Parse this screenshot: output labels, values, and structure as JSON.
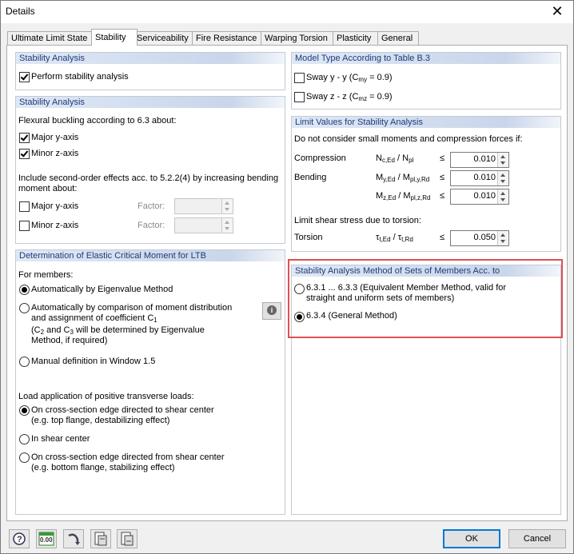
{
  "window": {
    "title": "Details",
    "close_glyph": "✕"
  },
  "tabs": [
    "Ultimate Limit State",
    "Stability",
    "Serviceability",
    "Fire Resistance",
    "Warping Torsion",
    "Plasticity",
    "General"
  ],
  "stability_analysis_1": {
    "header": "Stability Analysis",
    "perform_label": "Perform stability analysis",
    "perform_checked": true
  },
  "stability_analysis_2": {
    "header": "Stability Analysis",
    "flexural_label": "Flexural buckling according to 6.3 about:",
    "major_y": {
      "label": "Major y-axis",
      "checked": true
    },
    "minor_z": {
      "label": "Minor z-axis",
      "checked": true
    },
    "second_order_line1": "Include second-order effects acc. to 5.2.2(4) by increasing bending",
    "second_order_line2": "moment about:",
    "so_major_y": {
      "label": "Major y-axis",
      "checked": false,
      "factor_label": "Factor:",
      "factor_value": ""
    },
    "so_minor_z": {
      "label": "Minor z-axis",
      "checked": false,
      "factor_label": "Factor:",
      "factor_value": ""
    }
  },
  "ltb": {
    "header": "Determination of Elastic Critical Moment for LTB",
    "for_members": "For members:",
    "options": [
      {
        "text": "Automatically by Eigenvalue Method",
        "selected": true
      },
      {
        "text1": "Automatically by comparison of moment distribution",
        "text2": "and assignment of coefficient C",
        "text2_sub": "1",
        "text3a": "(C",
        "text3_sub1": "2",
        "text3b": " and C",
        "text3_sub2": "3",
        "text3c": " will be determined by Eigenvalue",
        "text4": "Method, if required)",
        "selected": false
      },
      {
        "text": "Manual definition in Window 1.5",
        "selected": false
      }
    ],
    "load_label": "Load application of positive transverse loads:",
    "load_options": [
      {
        "line1": "On cross-section edge directed to shear center",
        "line2": "(e.g. top flange, destabilizing effect)",
        "selected": true
      },
      {
        "line1": "In shear center",
        "line2": "",
        "selected": false
      },
      {
        "line1": "On cross-section edge directed from shear center",
        "line2": "(e.g. bottom flange, stabilizing effect)",
        "selected": false
      }
    ],
    "info_glyph": "i"
  },
  "model_type": {
    "header": "Model Type According to Table B.3",
    "sway_y": {
      "prefix": "Sway y - y (C",
      "sub": "my",
      "suffix": " = 0.9)",
      "checked": false
    },
    "sway_z": {
      "prefix": "Sway z - z (C",
      "sub": "mz",
      "suffix": " = 0.9)",
      "checked": false
    }
  },
  "limit_values": {
    "header": "Limit Values for Stability Analysis",
    "intro": "Do not consider small moments and compression forces if:",
    "compression": {
      "label": "Compression",
      "f_a": "N",
      "f_a_sub": "c,Ed",
      "f_b": " / N",
      "f_b_sub": "pl",
      "le": "≤",
      "value": "0.010"
    },
    "bending": {
      "label": "Bending",
      "f_a": "M",
      "f_a_sub": "y,Ed",
      "f_b": " / M",
      "f_b_sub": "pl,y,Rd",
      "le": "≤",
      "value": "0.010"
    },
    "bending2": {
      "f_a": "M",
      "f_a_sub": "z,Ed",
      "f_b": " / M",
      "f_b_sub": "pl,z,Rd",
      "le": "≤",
      "value": "0.010"
    },
    "shear_intro": "Limit shear stress due to torsion:",
    "torsion": {
      "label": "Torsion",
      "f_a": "τ",
      "f_a_sub": "t,Ed",
      "f_b": " / τ",
      "f_b_sub": "t,Rd",
      "le": "≤",
      "value": "0.050"
    }
  },
  "method": {
    "header": "Stability Analysis Method of Sets of Members Acc. to",
    "opt1_line1": "6.3.1 ... 6.3.3 (Equivalent Member Method, valid for",
    "opt1_line2": "straight and uniform sets of members)",
    "opt1_selected": false,
    "opt2": "6.3.4  (General Method)",
    "opt2_selected": true
  },
  "footer": {
    "ok_label": "OK",
    "cancel_label": "Cancel",
    "units_icon_text": "0.00"
  },
  "colors": {
    "group_header_text": "#1e3a78",
    "highlight": "#e05050",
    "accent": "#0078d7"
  }
}
